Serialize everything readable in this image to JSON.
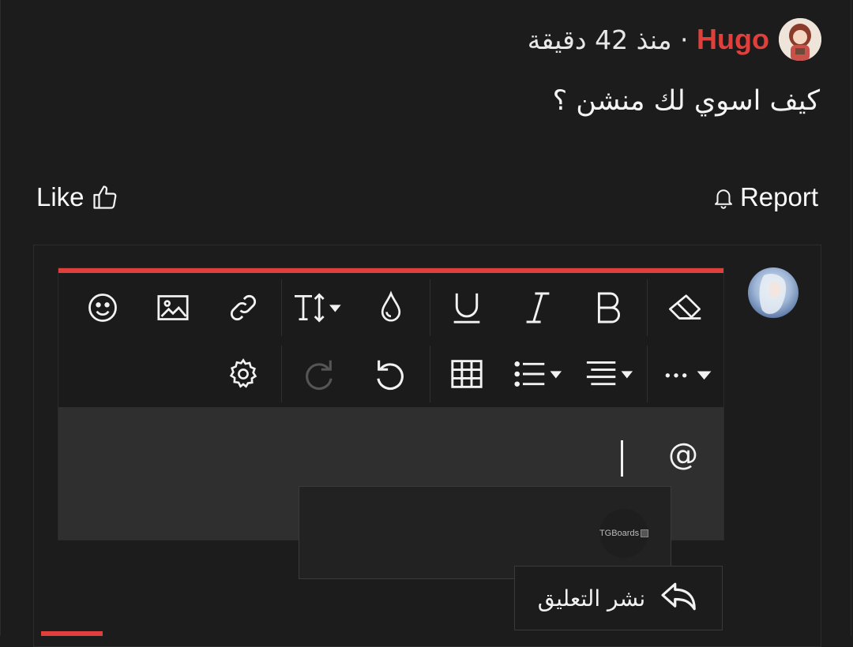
{
  "post": {
    "username": "Hugo",
    "separator": " · ",
    "time_ago": "منذ 42 دقيقة",
    "text": "كيف اسوي لك منشن ؟"
  },
  "actions": {
    "like_label": "Like",
    "report_label": "Report"
  },
  "toolbar": {
    "row1": [
      "eraser-icon",
      "bold-icon",
      "italic-icon",
      "underline-icon",
      "color-drop-icon",
      "font-size-icon",
      "link-icon",
      "image-icon",
      "emoji-icon"
    ],
    "row2": [
      "more-options-icon",
      "align-icon",
      "list-icon",
      "table-icon",
      "undo-icon",
      "redo-icon",
      "settings-icon"
    ]
  },
  "editor": {
    "content_text": "@"
  },
  "mention_popup": {
    "items": [
      {
        "label": "TGBoards"
      }
    ]
  },
  "submit": {
    "label": "نشر التعليق"
  },
  "colors": {
    "accent": "#e0403c",
    "background": "#1c1c1c",
    "editor_bg": "#2f2f2f"
  }
}
